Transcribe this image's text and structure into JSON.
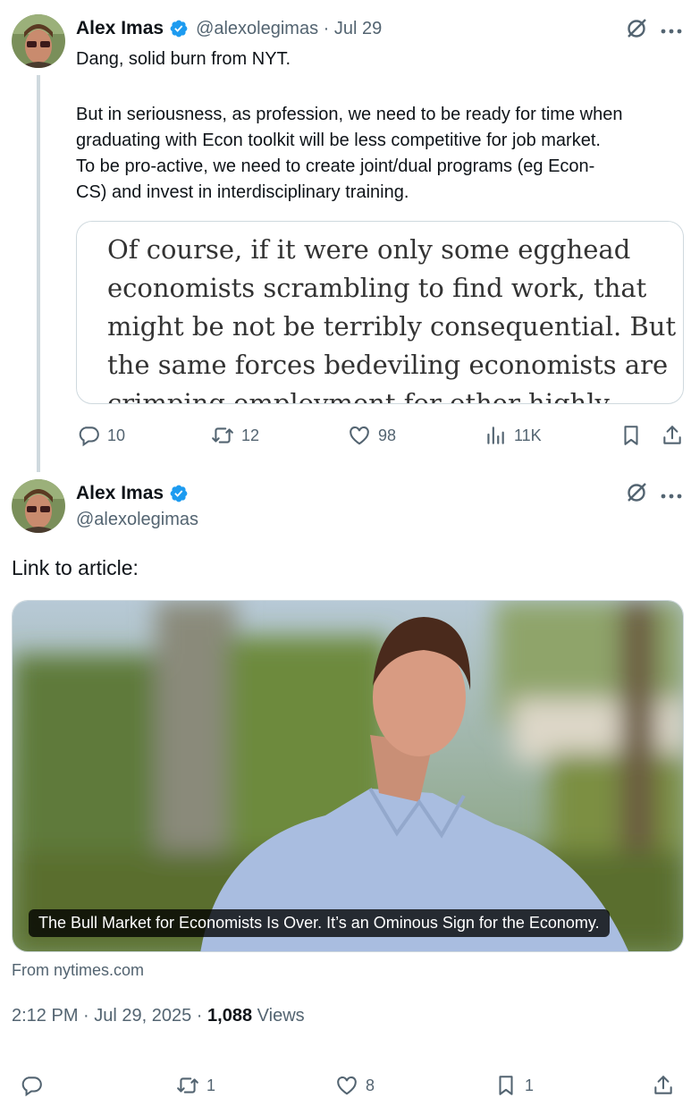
{
  "tweet1": {
    "name": "Alex Imas",
    "handle": "@alexolegimas",
    "date_sep": " · ",
    "date": "Jul 29",
    "lines": [
      "Dang, solid burn from NYT.",
      "",
      "But in seriousness, as profession, we need to be ready for time when",
      "graduating with Econ toolkit will be less competitive for job market.",
      "To be pro-active, we need to create joint/dual programs (eg Econ-",
      "CS) and invest in interdisciplinary training."
    ],
    "quote_lines": [
      "Of course, if it were only some egghead",
      "economists scrambling to find work, that",
      "might be not be terribly consequential. But",
      "the same forces bedeviling economists are",
      "crimping employment for other highly"
    ],
    "stats": {
      "replies": "10",
      "reposts": "12",
      "likes": "98",
      "views": "11K"
    }
  },
  "tweet2": {
    "name": "Alex Imas",
    "handle": "@alexolegimas",
    "text": "Link to article:",
    "card": {
      "caption": "The Bull Market for Economists Is Over. It’s an Ominous Sign for the Economy.",
      "source": "From nytimes.com"
    },
    "meta": {
      "time": "2:12 PM",
      "sep": " · ",
      "date": "Jul 29, 2025",
      "views_count": "1,088",
      "views_label": " Views"
    },
    "stats": {
      "reposts": "1",
      "likes": "8",
      "bookmarks": "1"
    }
  },
  "colors": {
    "verified": "#1d9bf0",
    "muted": "#536471",
    "border": "#cfd9de"
  },
  "icons": [
    "grok-icon",
    "more-icon",
    "reply-icon",
    "repost-icon",
    "like-icon",
    "views-icon",
    "bookmark-icon",
    "share-icon",
    "verified-badge-icon"
  ]
}
